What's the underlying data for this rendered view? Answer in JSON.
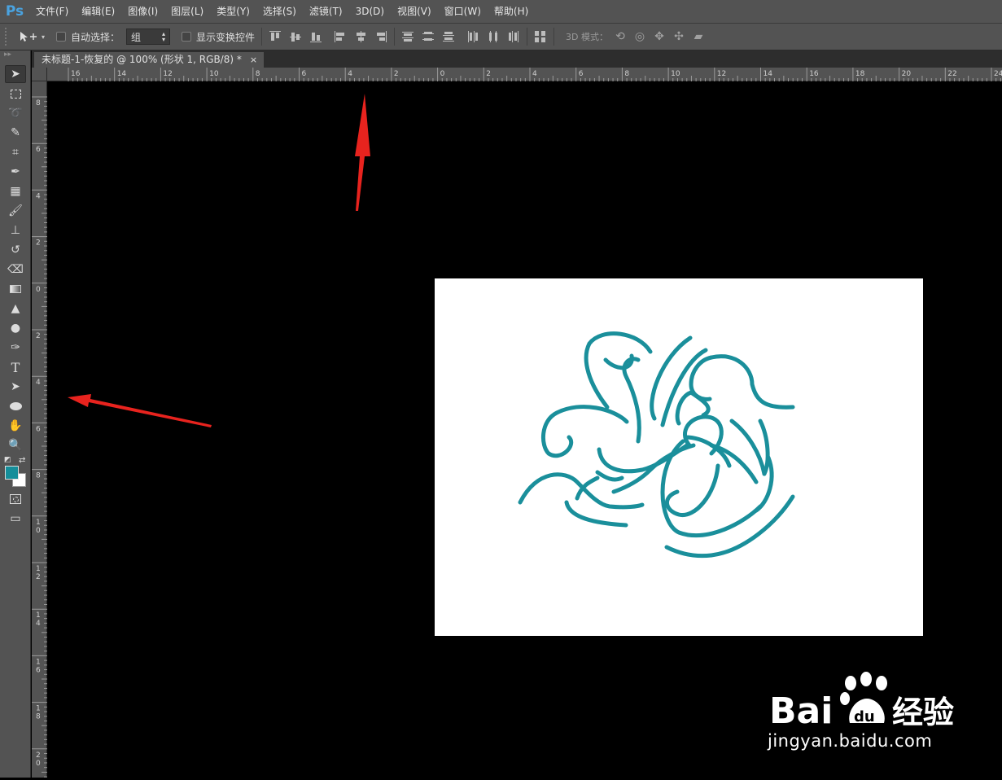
{
  "app": {
    "logo": "Ps"
  },
  "menu": {
    "items": [
      "文件(F)",
      "编辑(E)",
      "图像(I)",
      "图层(L)",
      "类型(Y)",
      "选择(S)",
      "滤镜(T)",
      "3D(D)",
      "视图(V)",
      "窗口(W)",
      "帮助(H)"
    ]
  },
  "options": {
    "auto_select_label": "自动选择：",
    "auto_select_value": "组",
    "show_transform_label": "显示变换控件",
    "mode3d_label": "3D 模式："
  },
  "document": {
    "tab_title": "未标题-1-恢复的 @ 100% (形状 1, RGB/8) *",
    "close_glyph": "×"
  },
  "rulers": {
    "horizontal_labels": [
      "16",
      "14",
      "12",
      "10",
      "8",
      "6",
      "4",
      "2",
      "0",
      "2",
      "4",
      "6",
      "8",
      "10",
      "12",
      "14",
      "16",
      "18",
      "20",
      "22",
      "24"
    ],
    "vertical_labels": [
      "8",
      "6",
      "4",
      "2",
      "0",
      "2",
      "4",
      "6",
      "8",
      "10",
      "12",
      "14",
      "16",
      "18",
      "20"
    ]
  },
  "colors": {
    "foreground": "#158e9a",
    "background": "#ffffff",
    "artwork_stroke": "#1a8f9b",
    "annotation_arrow": "#e8231e"
  },
  "watermark": {
    "brand_text": "Bai",
    "brand_suffix": "du",
    "product": "经验",
    "domain": "jingyan.baidu.com"
  }
}
